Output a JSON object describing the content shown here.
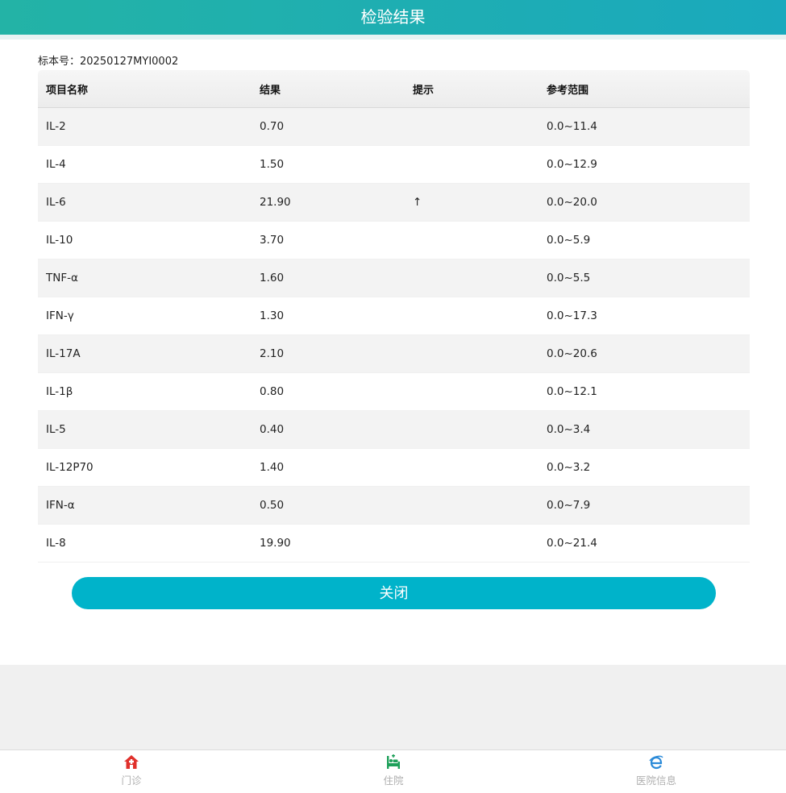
{
  "header": {
    "title": "检验结果"
  },
  "specimen": {
    "label": "标本号：20250127MYI0002"
  },
  "table": {
    "headers": [
      "项目名称",
      "结果",
      "提示",
      "参考范围"
    ],
    "rows": [
      {
        "name": "IL-2",
        "result": "0.70",
        "hint": "",
        "range": "0.0~11.4"
      },
      {
        "name": "IL-4",
        "result": "1.50",
        "hint": "",
        "range": "0.0~12.9"
      },
      {
        "name": "IL-6",
        "result": "21.90",
        "hint": "↑",
        "range": "0.0~20.0"
      },
      {
        "name": "IL-10",
        "result": "3.70",
        "hint": "",
        "range": "0.0~5.9"
      },
      {
        "name": "TNF-α",
        "result": "1.60",
        "hint": "",
        "range": "0.0~5.5"
      },
      {
        "name": "IFN-γ",
        "result": "1.30",
        "hint": "",
        "range": "0.0~17.3"
      },
      {
        "name": "IL-17A",
        "result": "2.10",
        "hint": "",
        "range": "0.0~20.6"
      },
      {
        "name": "IL-1β",
        "result": "0.80",
        "hint": "",
        "range": "0.0~12.1"
      },
      {
        "name": "IL-5",
        "result": "0.40",
        "hint": "",
        "range": "0.0~3.4"
      },
      {
        "name": "IL-12P70",
        "result": "1.40",
        "hint": "",
        "range": "0.0~3.2"
      },
      {
        "name": "IFN-α",
        "result": "0.50",
        "hint": "",
        "range": "0.0~7.9"
      },
      {
        "name": "IL-8",
        "result": "19.90",
        "hint": "",
        "range": "0.0~21.4"
      }
    ]
  },
  "actions": {
    "close_label": "关闭"
  },
  "nav": {
    "items": [
      {
        "label": "门诊",
        "icon": "outpatient-house-icon",
        "color": "#e0302b"
      },
      {
        "label": "住院",
        "icon": "inpatient-bed-icon",
        "color": "#1ea05a"
      },
      {
        "label": "医院信息",
        "icon": "hospital-info-e-icon",
        "color": "#2a8ad8"
      }
    ]
  },
  "colors": {
    "header_start": "#23b3a6",
    "header_end": "#1aa9bd",
    "button": "#00b3ca"
  }
}
